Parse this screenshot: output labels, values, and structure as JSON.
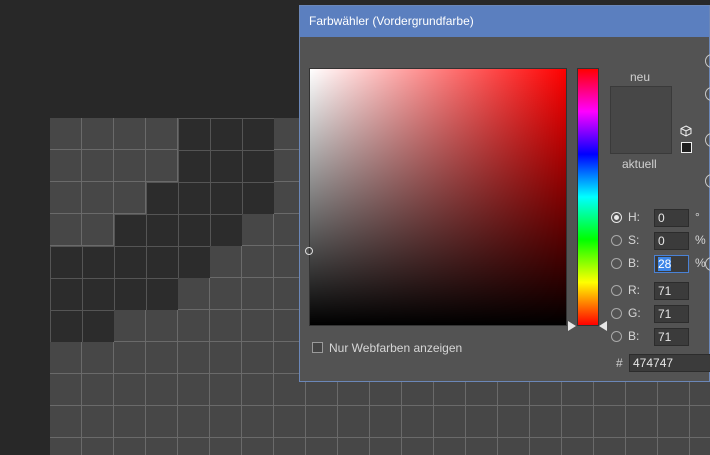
{
  "dialog": {
    "title": "Farbwähler (Vordergrundfarbe)",
    "new_label": "neu",
    "current_label": "aktuell",
    "swatch_color": "#474747",
    "webonly_label": "Nur Webfarben anzeigen",
    "hex_label": "#",
    "hex_value": "474747"
  },
  "hsb": [
    {
      "label": "H:",
      "value": "0",
      "unit": "°",
      "selected": true
    },
    {
      "label": "S:",
      "value": "0",
      "unit": "%",
      "selected": false
    },
    {
      "label": "B:",
      "value": "28",
      "unit": "%",
      "selected": false
    }
  ],
  "rgb": [
    {
      "label": "R:",
      "value": "71"
    },
    {
      "label": "G:",
      "value": "71"
    },
    {
      "label": "B:",
      "value": "71"
    }
  ],
  "icons": {
    "cube": "cube-icon",
    "websafe": "websafe-square-icon"
  },
  "colors": {
    "accent": "#5b7fbf",
    "canvas": "#474747"
  }
}
